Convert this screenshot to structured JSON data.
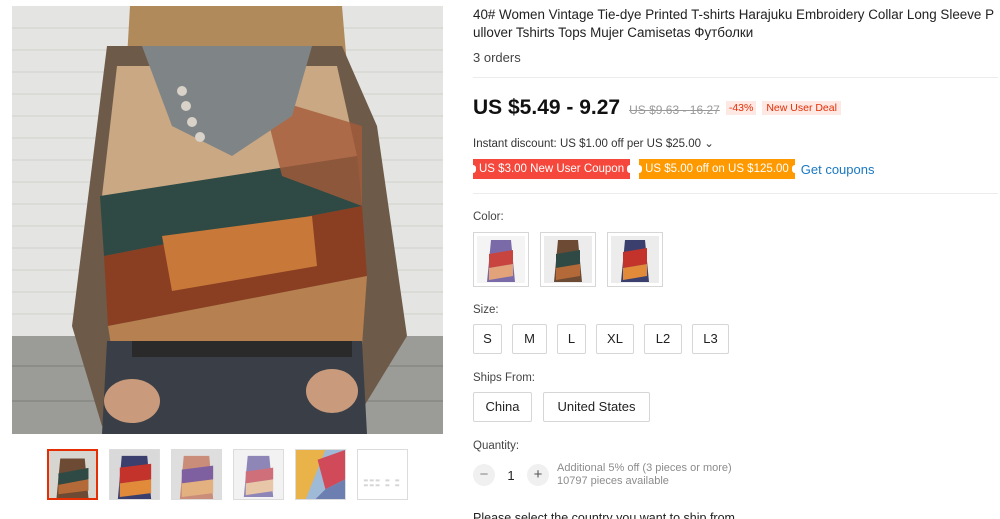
{
  "product": {
    "title": "40# Women Vintage Tie-dye Printed T-shirts Harajuku Embroidery Collar Long Sleeve Pullover Tshirts Tops Mujer Camisetas Футболки",
    "orders": "3 orders"
  },
  "gallery": {
    "main_image_alt": "woman wearing patchwork long sleeve top",
    "thumbnails": [
      {
        "icon": "thumb-brown-patchwork"
      },
      {
        "icon": "thumb-red-blue-patchwork"
      },
      {
        "icon": "thumb-peach-patchwork"
      },
      {
        "icon": "thumb-lilac-patchwork"
      },
      {
        "icon": "thumb-color-swatch"
      },
      {
        "icon": "thumb-size-chart"
      }
    ]
  },
  "price": {
    "current": "US $5.49 - 9.27",
    "original": "US $9.63 - 16.27",
    "discount": "-43%",
    "deal_badge": "New User Deal"
  },
  "instant_discount": "Instant discount: US $1.00 off per US $25.00 ⌄",
  "coupons": {
    "new_user": "US $3.00 New User Coupon",
    "store": "US $5.00 off on US $125.00",
    "get_label": "Get coupons"
  },
  "color": {
    "label": "Color:",
    "options": [
      "purple-red patchwork",
      "brown patchwork",
      "red-blue patchwork"
    ]
  },
  "size": {
    "label": "Size:",
    "options": [
      "S",
      "M",
      "L",
      "XL",
      "L2",
      "L3"
    ]
  },
  "ships_from": {
    "label": "Ships From:",
    "options": [
      "China",
      "United States"
    ]
  },
  "quantity": {
    "label": "Quantity:",
    "minus": "−",
    "value": "1",
    "plus": "+",
    "bulk_note": "Additional 5% off (3 pieces or more)",
    "available": "10797 pieces available"
  },
  "shipping_prompt": "Please select the country you want to ship from",
  "colors": {
    "accent": "#e62e04",
    "coupon_red": "#f5473b",
    "coupon_orange": "#ff9900",
    "link": "#1a78c2"
  }
}
